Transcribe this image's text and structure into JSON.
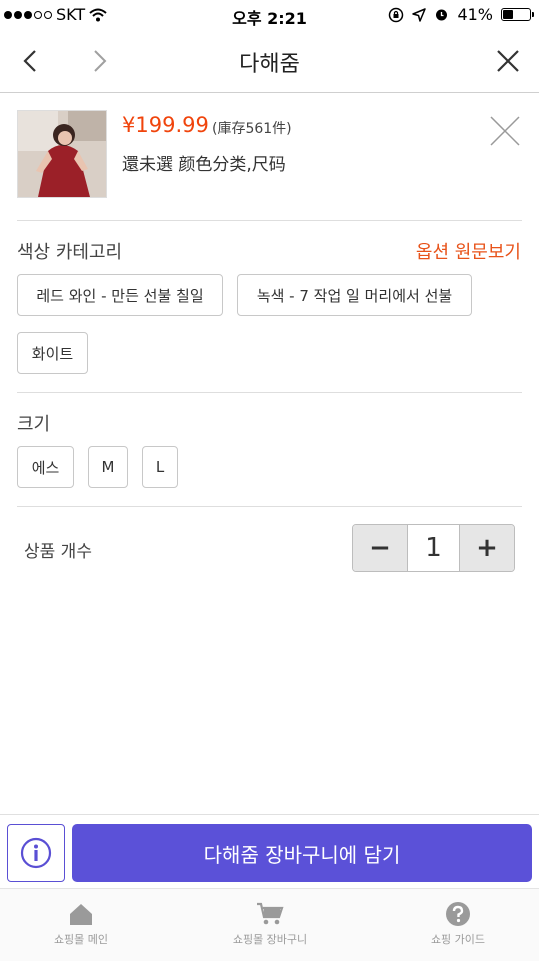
{
  "status_bar": {
    "carrier": "SKT",
    "time": "오후 2:21",
    "battery": "41%",
    "battery_level": 0.41
  },
  "nav": {
    "title": "다해줌"
  },
  "product": {
    "price": "¥199.99",
    "stock": "(庫存561件)",
    "variant": "還未選 颜色分类,尺码"
  },
  "options": {
    "color_title": "색상 카테고리",
    "original_link": "옵션 원문보기",
    "colors": [
      "레드 와인 - 만든 선불 칠일",
      "녹색 - 7 작업 일 머리에서 선불",
      "화이트"
    ],
    "size_title": "크기",
    "sizes": [
      "에스",
      "M",
      "L"
    ]
  },
  "quantity": {
    "label": "상품 개수",
    "minus": "−",
    "value": "1",
    "plus": "+"
  },
  "action": {
    "cart_button": "다해줌 장바구니에 담기"
  },
  "tab_bar": {
    "items": [
      {
        "label": "쇼핑몰 메인",
        "icon": "home-icon"
      },
      {
        "label": "쇼핑몰 장바구니",
        "icon": "cart-icon"
      },
      {
        "label": "쇼핑 가이드",
        "icon": "help-icon"
      }
    ]
  },
  "colors": {
    "accent": "#5b51d8",
    "price": "#f0440c",
    "link": "#e8531a"
  }
}
